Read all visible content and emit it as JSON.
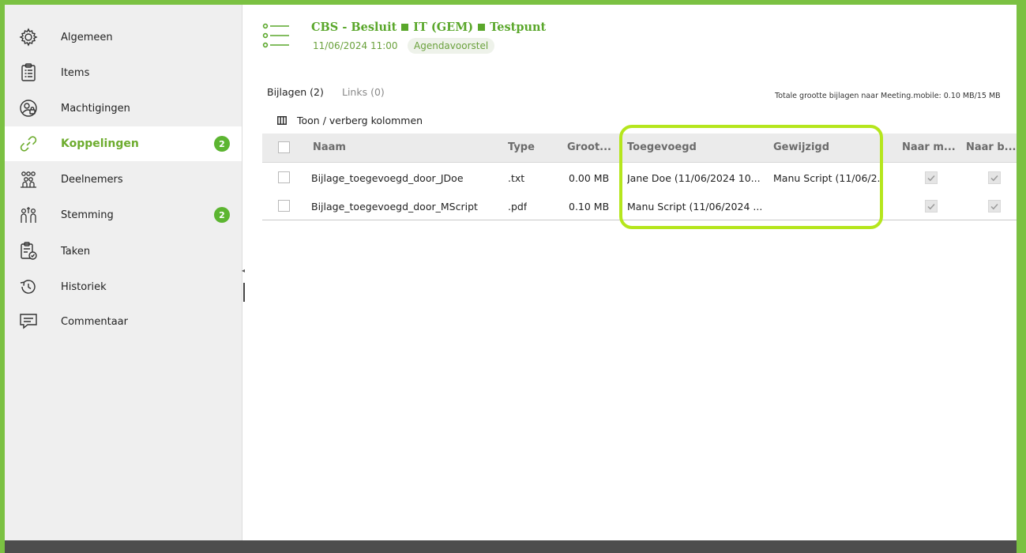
{
  "sidebar": {
    "items": [
      {
        "label": "Algemeen",
        "icon": "gear-icon"
      },
      {
        "label": "Items",
        "icon": "clipboard-list-icon"
      },
      {
        "label": "Machtigingen",
        "icon": "user-lock-icon"
      },
      {
        "label": "Koppelingen",
        "icon": "link-icon",
        "badge": "2",
        "active": true
      },
      {
        "label": "Deelnemers",
        "icon": "people-group-icon"
      },
      {
        "label": "Stemming",
        "icon": "voting-people-icon",
        "badge": "2"
      },
      {
        "label": "Taken",
        "icon": "clipboard-check-icon"
      },
      {
        "label": "Historiek",
        "icon": "history-clock-icon"
      },
      {
        "label": "Commentaar",
        "icon": "comment-icon"
      }
    ]
  },
  "header": {
    "title_part1": "CBS - Besluit",
    "title_part2": "IT (GEM)",
    "title_part3": "Testpunt",
    "datetime": "11/06/2024 11:00",
    "status_chip": "Agendavoorstel",
    "icon": "agenda-list-icon"
  },
  "tabs": [
    {
      "label": "Bijlagen (2)",
      "active": true
    },
    {
      "label": "Links (0)",
      "active": false
    }
  ],
  "size_info": "Totale grootte bijlagen naar Meeting.mobile: 0.10 MB/15 MB",
  "toolbar": {
    "toggle_columns_label": "Toon / verberg kolommen",
    "icon": "columns-icon"
  },
  "table": {
    "columns": {
      "name": "Naam",
      "type": "Type",
      "size": "Groot...",
      "added": "Toegevoegd",
      "modified": "Gewijzigd",
      "to_meeting": "Naar m...",
      "to_b": "Naar b..."
    },
    "rows": [
      {
        "name": "Bijlage_toegevoegd_door_JDoe",
        "type": ".txt",
        "size": "0.00 MB",
        "added": "Jane Doe (11/06/2024 10...",
        "modified": "Manu Script (11/06/2...",
        "to_meeting": true,
        "to_b": true
      },
      {
        "name": "Bijlage_toegevoegd_door_MScript",
        "type": ".pdf",
        "size": "0.10 MB",
        "added": "Manu Script (11/06/2024 ...",
        "modified": "",
        "to_meeting": true,
        "to_b": true
      }
    ]
  },
  "colors": {
    "accent_green": "#5cb531",
    "frame_green": "#7bc142",
    "highlight_lime": "#b5e61d"
  }
}
